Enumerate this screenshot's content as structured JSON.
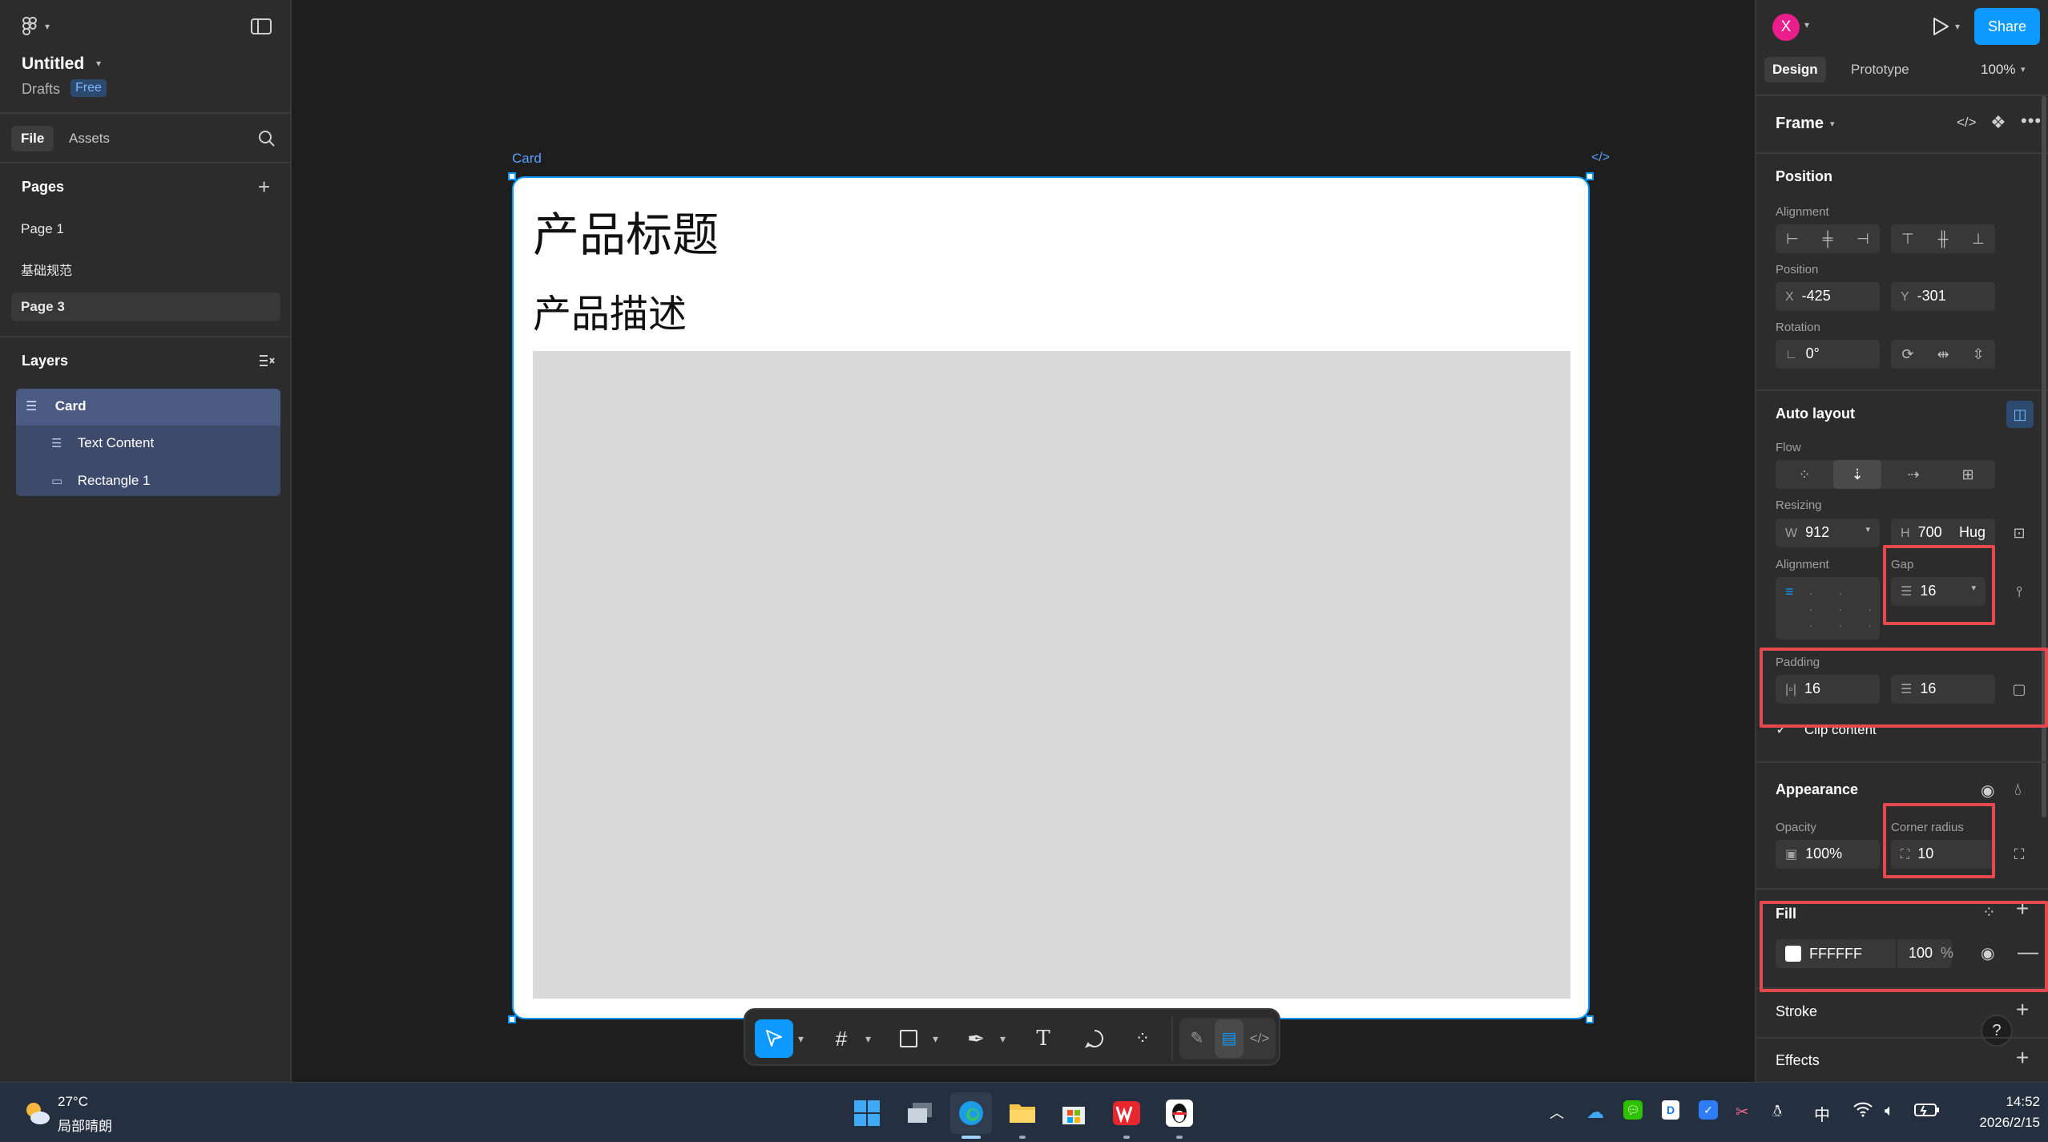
{
  "left_panel": {
    "file_title": "Untitled",
    "location": "Drafts",
    "plan_badge": "Free",
    "tabs": [
      "File",
      "Assets"
    ],
    "pages_heading": "Pages",
    "pages": [
      "Page 1",
      "基础规范",
      "Page 3"
    ],
    "selected_page": "Page 3",
    "layers_heading": "Layers",
    "layers": [
      {
        "name": "Card",
        "icon": "auto-layout-icon",
        "depth": 0
      },
      {
        "name": "Text Content",
        "icon": "auto-layout-icon",
        "depth": 1
      },
      {
        "name": "Rectangle 1",
        "icon": "rectangle-icon",
        "depth": 1
      }
    ]
  },
  "canvas": {
    "frame_label": "Card",
    "code_label": "</>",
    "card": {
      "title": "产品标题",
      "description": "产品描述"
    }
  },
  "right_panel": {
    "avatar_letter": "X",
    "share_label": "Share",
    "tabs": [
      "Design",
      "Prototype"
    ],
    "zoom": "100%",
    "frame_type": "Frame",
    "position": {
      "heading": "Position",
      "alignment_label": "Alignment",
      "position_label": "Position",
      "x_prefix": "X",
      "x": "-425",
      "y_prefix": "Y",
      "y": "-301",
      "rotation_label": "Rotation",
      "rotation": "0°"
    },
    "auto_layout": {
      "heading": "Auto layout",
      "flow_label": "Flow",
      "resizing_label": "Resizing",
      "w_prefix": "W",
      "width": "912",
      "h_prefix": "H",
      "height": "700",
      "height_mode": "Hug",
      "alignment_label": "Alignment",
      "gap_label": "Gap",
      "gap": "16",
      "padding_label": "Padding",
      "padding_h": "16",
      "padding_v": "16",
      "clip_content": "Clip content"
    },
    "appearance": {
      "heading": "Appearance",
      "opacity_label": "Opacity",
      "opacity": "100%",
      "corner_radius_label": "Corner radius",
      "corner_radius": "10"
    },
    "fill": {
      "heading": "Fill",
      "hex": "FFFFFF",
      "opacity": "100",
      "percent": "%"
    },
    "stroke_heading": "Stroke",
    "effects_heading": "Effects",
    "help": "?"
  },
  "taskbar": {
    "weather_temp": "27°C",
    "weather_desc": "局部晴朗",
    "ime": "中",
    "time": "14:52",
    "date": "2026/2/15"
  },
  "colors": {
    "accent": "#0d99ff",
    "highlight": "#e5484d",
    "avatar": "#e91e8c",
    "layer_selection": "#3d4a6b",
    "placeholder_gray": "#d9d9d9"
  }
}
